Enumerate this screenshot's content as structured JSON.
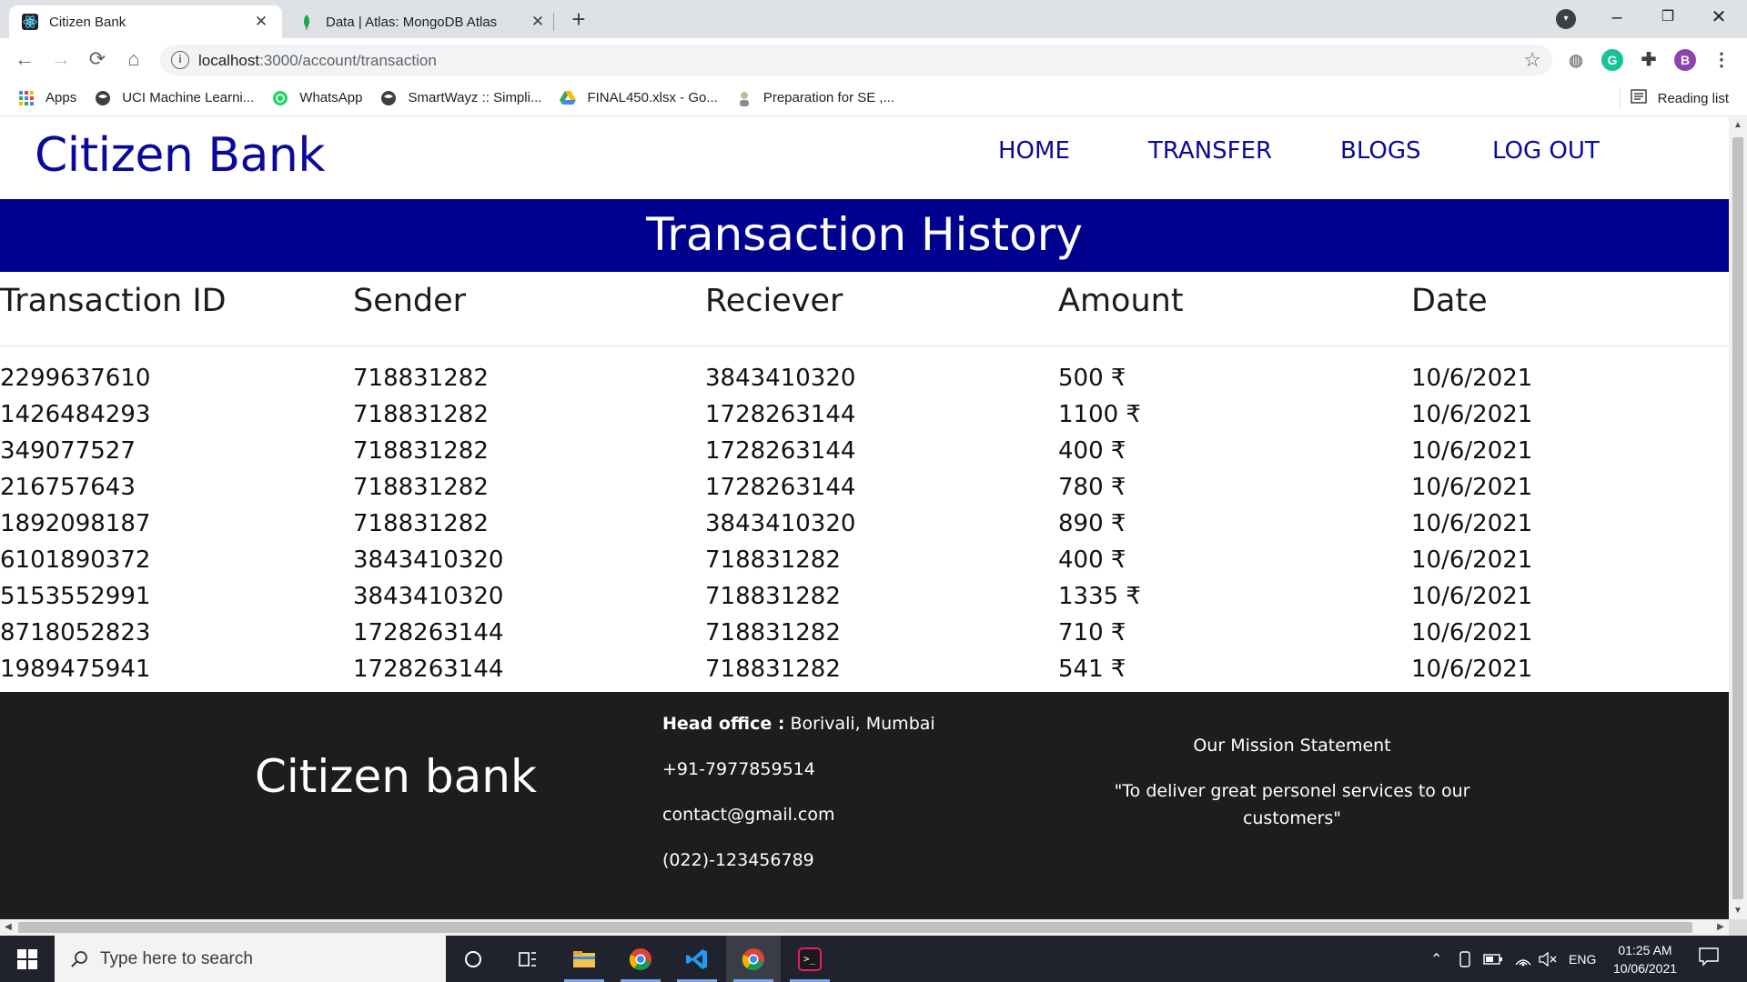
{
  "browser": {
    "tabs": [
      {
        "title": "Citizen Bank"
      },
      {
        "title": "Data | Atlas: MongoDB Atlas"
      }
    ],
    "url": {
      "host": "localhost",
      "path": ":3000/account/transaction"
    },
    "profile_initial": "B",
    "bookmarks": [
      {
        "label": "Apps",
        "icon": "apps-grid-icon"
      },
      {
        "label": "UCI Machine Learni...",
        "icon": "globe-icon"
      },
      {
        "label": "WhatsApp",
        "icon": "whatsapp-icon"
      },
      {
        "label": "SmartWayz :: Simpli...",
        "icon": "globe-icon"
      },
      {
        "label": "FINAL450.xlsx - Go...",
        "icon": "drive-icon"
      },
      {
        "label": "Preparation for SE ,...",
        "icon": "person-icon"
      }
    ],
    "reading_list": "Reading list"
  },
  "site": {
    "brand": "Citizen Bank",
    "nav": [
      "HOME",
      "TRANSFER",
      "BLOGS",
      "LOG OUT"
    ],
    "banner": "Transaction History",
    "columns": [
      "Transaction ID",
      "Sender",
      "Reciever",
      "Amount",
      "Date"
    ],
    "rows": [
      [
        "2299637610",
        "718831282",
        "3843410320",
        "500 ₹",
        "10/6/2021"
      ],
      [
        "1426484293",
        "718831282",
        "1728263144",
        "1100 ₹",
        "10/6/2021"
      ],
      [
        "349077527",
        "718831282",
        "1728263144",
        "400 ₹",
        "10/6/2021"
      ],
      [
        "216757643",
        "718831282",
        "1728263144",
        "780 ₹",
        "10/6/2021"
      ],
      [
        "1892098187",
        "718831282",
        "3843410320",
        "890 ₹",
        "10/6/2021"
      ],
      [
        "6101890372",
        "3843410320",
        "718831282",
        "400 ₹",
        "10/6/2021"
      ],
      [
        "5153552991",
        "3843410320",
        "718831282",
        "1335 ₹",
        "10/6/2021"
      ],
      [
        "8718052823",
        "1728263144",
        "718831282",
        "710 ₹",
        "10/6/2021"
      ],
      [
        "1989475941",
        "1728263144",
        "718831282",
        "541 ₹",
        "10/6/2021"
      ]
    ],
    "footer": {
      "brand": "Citizen bank",
      "head_office_label": "Head office :",
      "head_office_value": " Borivali, Mumbai",
      "phone": "+91-7977859514",
      "email": "contact@gmail.com",
      "landline": "(022)-123456789",
      "mission_title": "Our Mission Statement",
      "mission_text": "\"To deliver great personel services to our customers\""
    }
  },
  "taskbar": {
    "search_placeholder": "Type here to search",
    "language": "ENG",
    "time": "01:25 AM",
    "date": "10/06/2021"
  },
  "colors": {
    "brand_blue": "#0a0a9a",
    "banner_blue": "#01018f",
    "footer_bg": "#1d1d1d"
  }
}
